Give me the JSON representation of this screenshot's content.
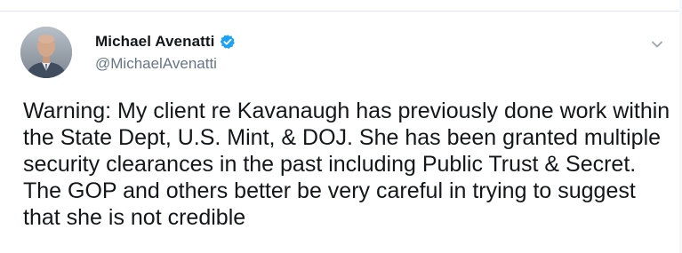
{
  "colors": {
    "text_primary": "#14171a",
    "text_secondary": "#657786",
    "verified_blue": "#1da1f2",
    "divider": "#e1e8ed"
  },
  "tweet": {
    "author": {
      "display_name": "Michael Avenatti",
      "handle": "@MichaelAvenatti",
      "verified": true,
      "avatar_icon": "profile-photo",
      "verified_icon": "verified-badge-icon"
    },
    "menu_icon": "chevron-down-icon",
    "text": "Warning: My client re Kavanaugh has previously done work within the State Dept, U.S. Mint, & DOJ. She has been granted multiple security clearances in the past including Public Trust & Secret. The GOP and others better be very careful in trying to suggest that she is not credible"
  }
}
